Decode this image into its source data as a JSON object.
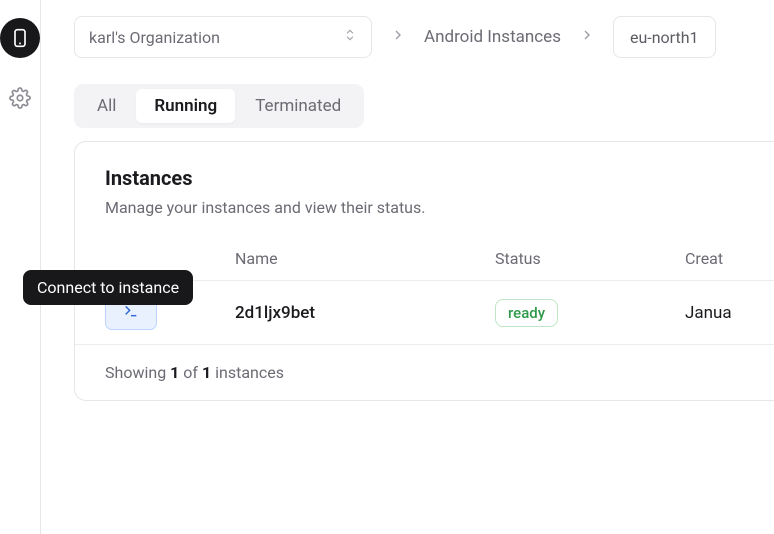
{
  "breadcrumbs": {
    "org_label": "karl's Organization",
    "section": "Android Instances",
    "region": "eu-north1"
  },
  "tabs": {
    "all": "All",
    "running": "Running",
    "terminated": "Terminated"
  },
  "card": {
    "title": "Instances",
    "subtitle": "Manage your instances and view their status."
  },
  "columns": {
    "name": "Name",
    "status": "Status",
    "created": "Creat"
  },
  "row": {
    "name": "2d1ljx9bet",
    "status": "ready",
    "created": "Janua"
  },
  "footer": {
    "prefix": "Showing ",
    "shown": "1",
    "of_word": " of ",
    "total": "1",
    "suffix": " instances"
  },
  "tooltip": "Connect to instance"
}
